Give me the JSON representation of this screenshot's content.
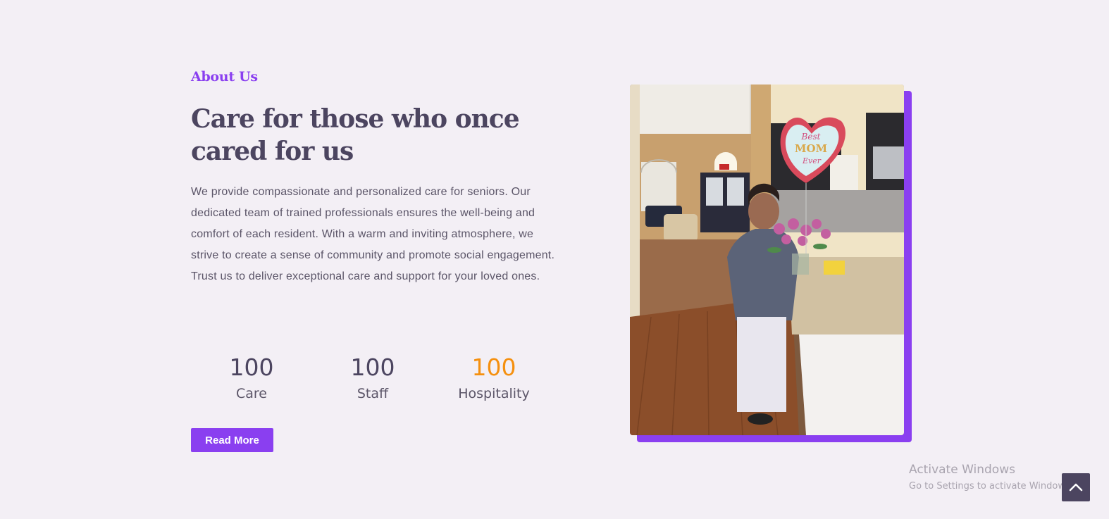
{
  "about": {
    "eyebrow": "About Us",
    "title": "Care for those who once cared for us",
    "description": "We provide compassionate and personalized care for seniors. Our dedicated team of trained professionals ensures the well-being and comfort of each resident. With a warm and inviting atmosphere, we strive to create a sense of community and promote social engagement. Trust us to deliver exceptional care and support for your loved ones.",
    "read_more_label": "Read More"
  },
  "stats": [
    {
      "value": "100",
      "label": "Care"
    },
    {
      "value": "100",
      "label": "Staff"
    },
    {
      "value": "100",
      "label": "Hospitality"
    }
  ],
  "photo": {
    "balloon_text": "Best MOM Ever"
  },
  "watermark": {
    "title": "Activate Windows",
    "subtitle": "Go to Settings to activate Windows."
  },
  "scroll_top": {
    "icon": "chevron-up-icon"
  },
  "colors": {
    "background": "#f3eff5",
    "accent": "#8a3ff0",
    "heading": "#4c4560",
    "stat_highlight": "#f5900f"
  }
}
